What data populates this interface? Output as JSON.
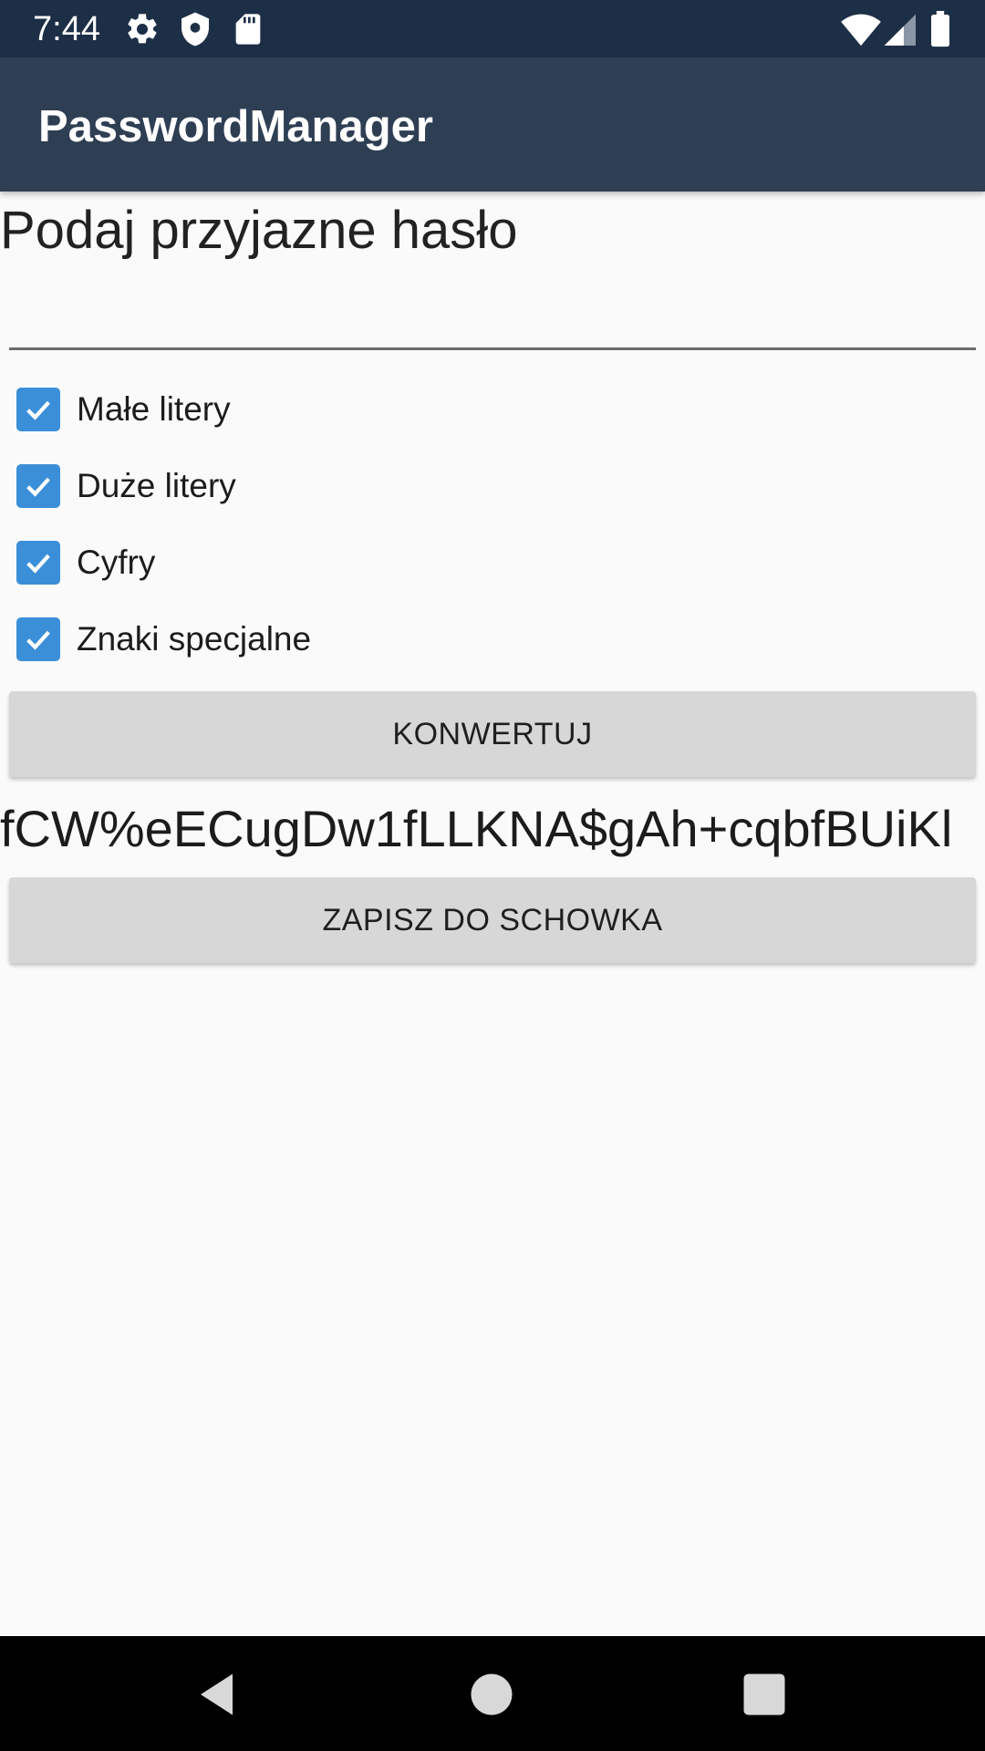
{
  "status_bar": {
    "time": "7:44",
    "icons": [
      "gear-icon",
      "shield-icon",
      "sd-card-icon",
      "wifi-icon",
      "signal-icon",
      "battery-icon"
    ]
  },
  "app_bar": {
    "title": "PasswordManager"
  },
  "main": {
    "prompt": "Podaj przyjazne hasło",
    "input_value": "",
    "options": [
      {
        "label": "Małe litery",
        "checked": true
      },
      {
        "label": "Duże litery",
        "checked": true
      },
      {
        "label": "Cyfry",
        "checked": true
      },
      {
        "label": "Znaki specjalne",
        "checked": true
      }
    ],
    "convert_button": "KONWERTUJ",
    "generated_password": "fCW%eECugDw1fLLKNA$gAh+cqbfBUiKl",
    "copy_button": "ZAPISZ DO SCHOWKA"
  },
  "nav_bar": {
    "icons": [
      "back-icon",
      "home-icon",
      "recents-icon"
    ]
  },
  "colors": {
    "status_bar": "#1d2f47",
    "app_bar": "#2e3e53",
    "checkbox_accent": "#3b8fd9",
    "button_bg": "#d7d7d7",
    "background": "#fafafa"
  }
}
